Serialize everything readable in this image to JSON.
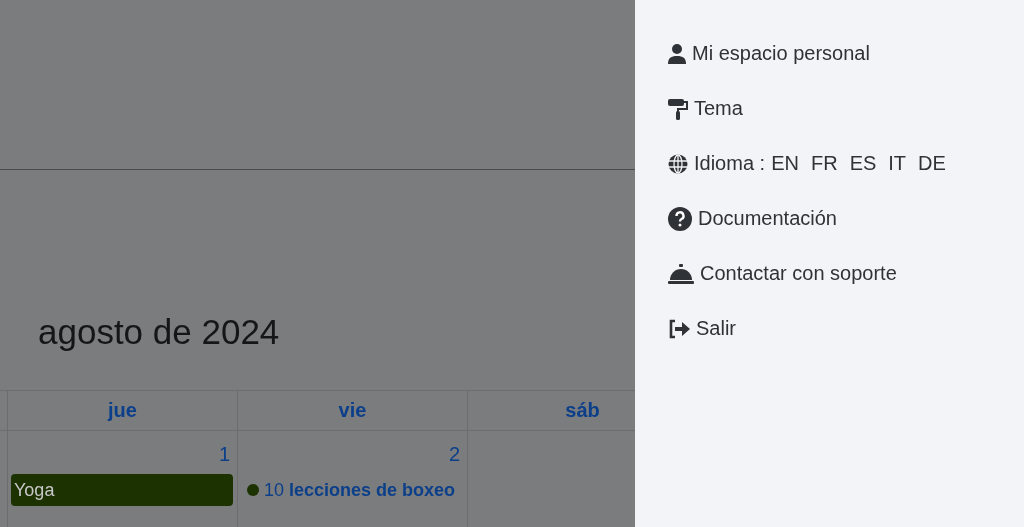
{
  "calendar": {
    "title": "agosto de 2024",
    "weekdays": [
      {
        "label": "jue"
      },
      {
        "label": "vie"
      },
      {
        "label": "sáb"
      }
    ],
    "days": [
      {
        "number": "1",
        "events": [
          {
            "kind": "block",
            "title": "Yoga",
            "color": "#1d3201"
          }
        ]
      },
      {
        "number": "2",
        "events": [
          {
            "kind": "dot",
            "time": "10",
            "title": "lecciones de boxeo",
            "color": "#1d3201"
          }
        ]
      }
    ]
  },
  "menu": {
    "items": [
      {
        "kind": "link",
        "label": "Mi espacio personal"
      },
      {
        "kind": "link",
        "label": "Tema"
      },
      {
        "kind": "language",
        "label": "Idioma :",
        "languages": [
          "EN",
          "FR",
          "ES",
          "IT",
          "DE"
        ]
      },
      {
        "kind": "link",
        "label": "Documentación"
      },
      {
        "kind": "link",
        "label": "Contactar con soporte"
      },
      {
        "kind": "link",
        "label": "Salir"
      }
    ]
  }
}
